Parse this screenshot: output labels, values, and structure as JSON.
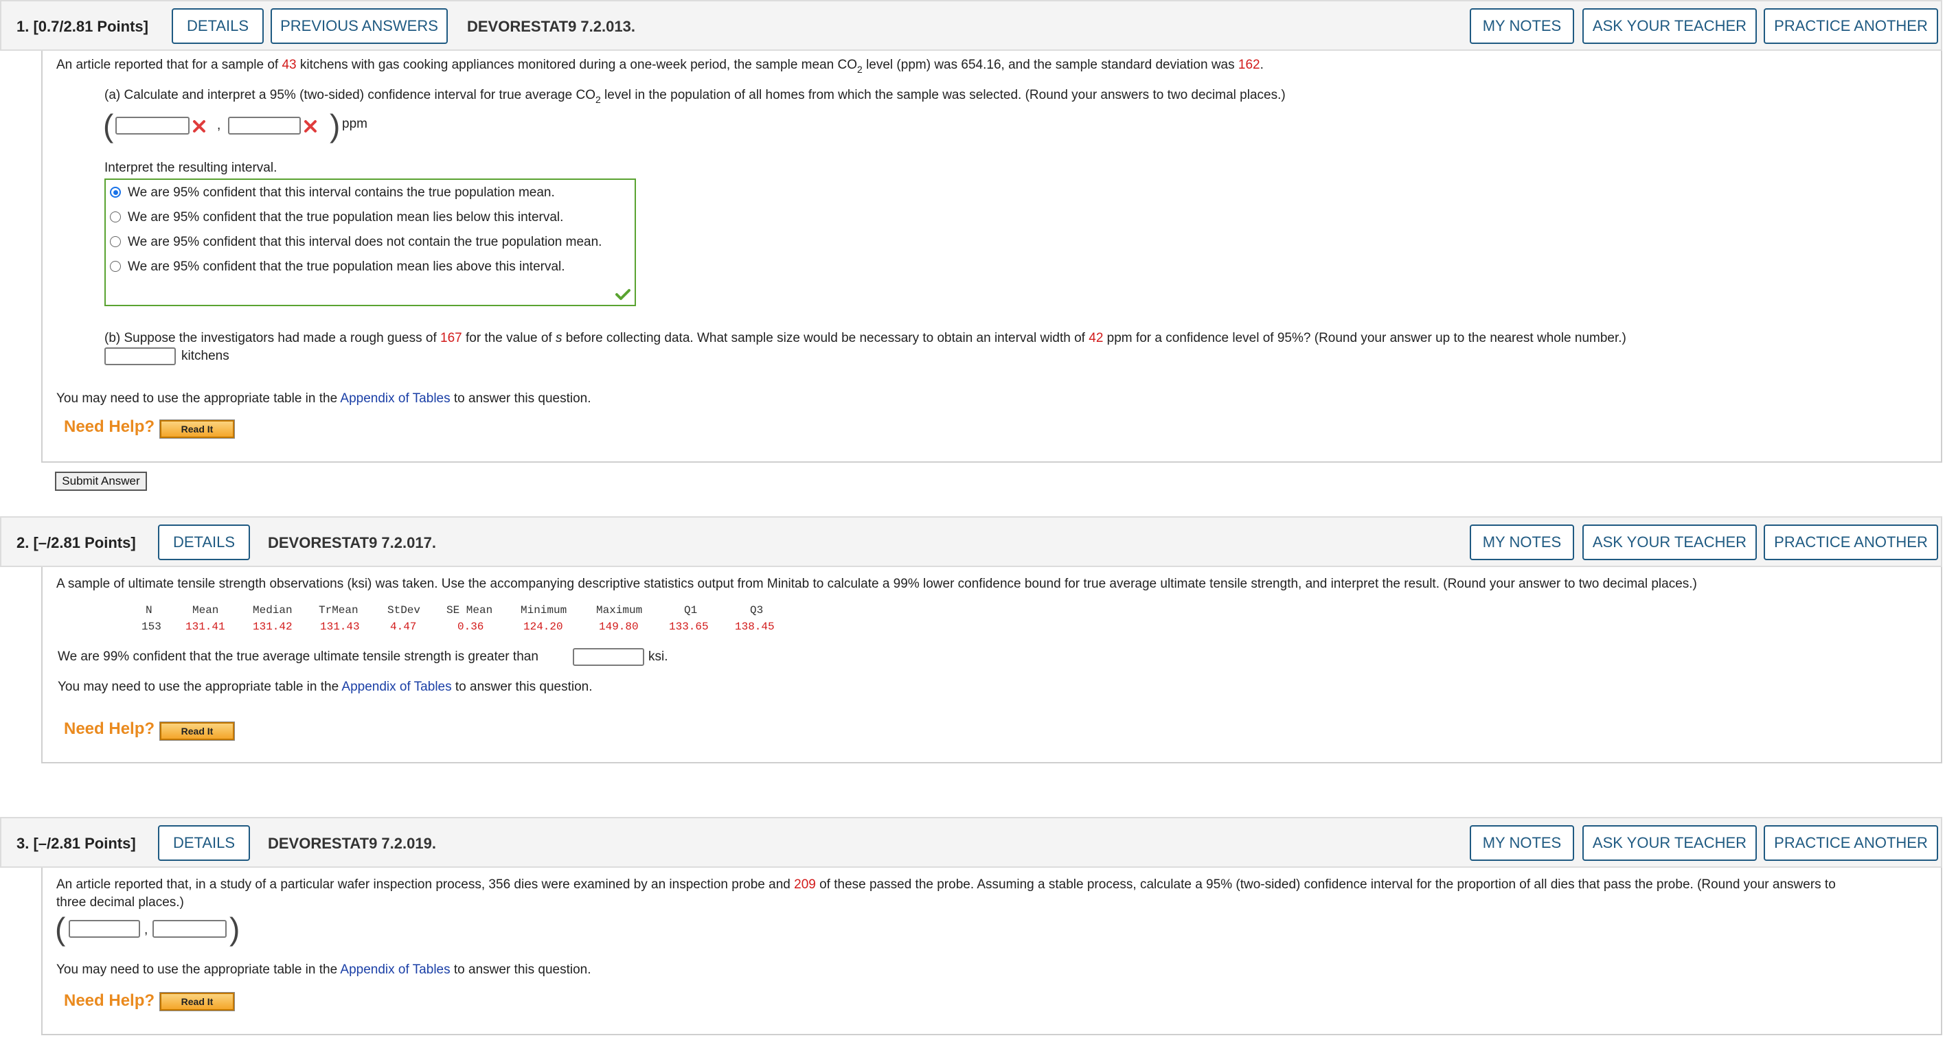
{
  "header_buttons": {
    "details": "DETAILS",
    "previous_answers": "PREVIOUS ANSWERS",
    "my_notes": "MY NOTES",
    "ask_teacher": "ASK YOUR TEACHER",
    "practice_another": "PRACTICE ANOTHER"
  },
  "common": {
    "appendix_pre": "You may need to use the appropriate table in the ",
    "appendix_link": "Appendix of Tables",
    "appendix_post": " to answer this question.",
    "need_help": "Need Help?",
    "read_it": "Read It"
  },
  "q1": {
    "num": "1.",
    "points": "[0.7/2.81 Points]",
    "code": "DEVORESTAT9 7.2.013.",
    "intro_1": "An article reported that for a sample of ",
    "kitchens": "43",
    "intro_2": " kitchens with gas cooking appliances monitored during a one-week period, the sample mean CO",
    "sub2": "2",
    "intro_3": " level (ppm) was 654.16, and the sample standard deviation was ",
    "sd": "162",
    "intro_4": ".",
    "part_a_1": "(a) Calculate and interpret a 95% (two-sided) confidence interval for true average CO",
    "part_a_2": " level in the population of all homes from which the sample was selected. (Round your answers to two decimal places.)",
    "comma": ",",
    "unit_ppm": "ppm",
    "interpret_label": "Interpret the resulting interval.",
    "options": [
      "We are 95% confident that this interval contains the true population mean.",
      "We are 95% confident that the true population mean lies below this interval.",
      "We are 95% confident that this interval does not contain the true population mean.",
      "We are 95% confident that the true population mean lies above this interval."
    ],
    "selected_option": 0,
    "part_b_1": "(b) Suppose the investigators had made a rough guess of ",
    "guess": "167",
    "part_b_2": " for the value of ",
    "s_var": "s",
    "part_b_3": " before collecting data. What sample size would be necessary to obtain an interval width of ",
    "width": "42",
    "part_b_4": " ppm for a confidence level of 95%? (Round your answer up to the nearest whole number.)",
    "unit_kitchens": "kitchens",
    "submit": "Submit Answer"
  },
  "q2": {
    "num": "2.",
    "points": "[–/2.81 Points]",
    "code": "DEVORESTAT9 7.2.017.",
    "intro": "A sample of ultimate tensile strength observations (ksi) was taken. Use the accompanying descriptive statistics output from Minitab to calculate a 99% lower confidence bound for true average ultimate tensile strength, and interpret the result. (Round your answer to two decimal places.)",
    "table_headers": [
      "N",
      "Mean",
      "Median",
      "TrMean",
      "StDev",
      "SE Mean",
      "Minimum",
      "Maximum",
      "Q1",
      "Q3"
    ],
    "table_values": [
      "153",
      "131.41",
      "131.42",
      "131.43",
      "4.47",
      "0.36",
      "124.20",
      "149.80",
      "133.65",
      "138.45"
    ],
    "answer_pre": "We are 99% confident that the true average ultimate tensile strength is greater than",
    "answer_unit": "ksi."
  },
  "q3": {
    "num": "3.",
    "points": "[–/2.81 Points]",
    "code": "DEVORESTAT9 7.2.019.",
    "intro_1": "An article reported that, in a study of a particular wafer inspection process, 356 dies were examined by an inspection probe and ",
    "passed": "209",
    "intro_2": " of these passed the probe. Assuming a stable process, calculate a 95% (two-sided) confidence interval for the proportion of all dies that pass the probe. (Round your answers to",
    "intro_3": "three decimal places.)",
    "comma": ","
  },
  "colors": {
    "accent": "#1f5a82",
    "highlight": "#d21b1b",
    "help": "#ea8a1e",
    "correct": "#5aa331",
    "incorrect": "#e03c3c",
    "link": "#1a3fa6"
  }
}
